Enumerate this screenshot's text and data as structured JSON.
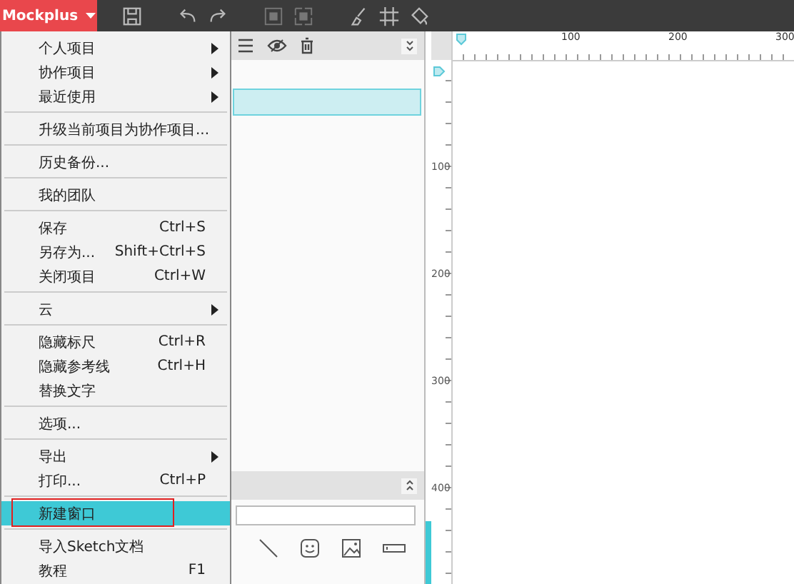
{
  "toolbar": {
    "app_button": {
      "label": "Mockplus"
    }
  },
  "main_menu": {
    "items": [
      {
        "kind": "item",
        "label": "个人项目",
        "has_submenu": true,
        "highlighted": false
      },
      {
        "kind": "item",
        "label": "协作项目",
        "has_submenu": true,
        "highlighted": false
      },
      {
        "kind": "item",
        "label": "最近使用",
        "has_submenu": true,
        "highlighted": false
      },
      {
        "kind": "separator"
      },
      {
        "kind": "item",
        "label": "升级当前项目为协作项目...",
        "has_submenu": false,
        "highlighted": false
      },
      {
        "kind": "separator"
      },
      {
        "kind": "item",
        "label": "历史备份...",
        "has_submenu": false,
        "highlighted": false
      },
      {
        "kind": "separator"
      },
      {
        "kind": "item",
        "label": "我的团队",
        "has_submenu": false,
        "highlighted": false
      },
      {
        "kind": "separator"
      },
      {
        "kind": "item",
        "label": "保存",
        "shortcut": "Ctrl+S",
        "has_submenu": false,
        "highlighted": false
      },
      {
        "kind": "item",
        "label": "另存为...",
        "shortcut": "Shift+Ctrl+S",
        "has_submenu": false,
        "highlighted": false
      },
      {
        "kind": "item",
        "label": "关闭项目",
        "shortcut": "Ctrl+W",
        "has_submenu": false,
        "highlighted": false
      },
      {
        "kind": "separator"
      },
      {
        "kind": "item",
        "label": "云",
        "has_submenu": true,
        "highlighted": false
      },
      {
        "kind": "separator"
      },
      {
        "kind": "item",
        "label": "隐藏标尺",
        "shortcut": "Ctrl+R",
        "has_submenu": false,
        "highlighted": false
      },
      {
        "kind": "item",
        "label": "隐藏参考线",
        "shortcut": "Ctrl+H",
        "has_submenu": false,
        "highlighted": false
      },
      {
        "kind": "item",
        "label": "替换文字",
        "has_submenu": false,
        "highlighted": false
      },
      {
        "kind": "separator"
      },
      {
        "kind": "item",
        "label": "选项...",
        "has_submenu": false,
        "highlighted": false
      },
      {
        "kind": "separator"
      },
      {
        "kind": "item",
        "label": "导出",
        "has_submenu": true,
        "highlighted": false
      },
      {
        "kind": "item",
        "label": "打印...",
        "shortcut": "Ctrl+P",
        "has_submenu": false,
        "highlighted": false
      },
      {
        "kind": "separator"
      },
      {
        "kind": "item",
        "label": "新建窗口",
        "has_submenu": false,
        "highlighted": true,
        "outlined": true
      },
      {
        "kind": "separator"
      },
      {
        "kind": "item",
        "label": "导入Sketch文档",
        "has_submenu": false,
        "highlighted": false
      },
      {
        "kind": "item",
        "label": "教程",
        "shortcut": "F1",
        "has_submenu": false,
        "highlighted": false
      }
    ]
  },
  "rulers": {
    "horizontal_labels": [
      "100",
      "200",
      "300"
    ],
    "vertical_labels": [
      "100",
      "200",
      "300",
      "400"
    ]
  }
}
